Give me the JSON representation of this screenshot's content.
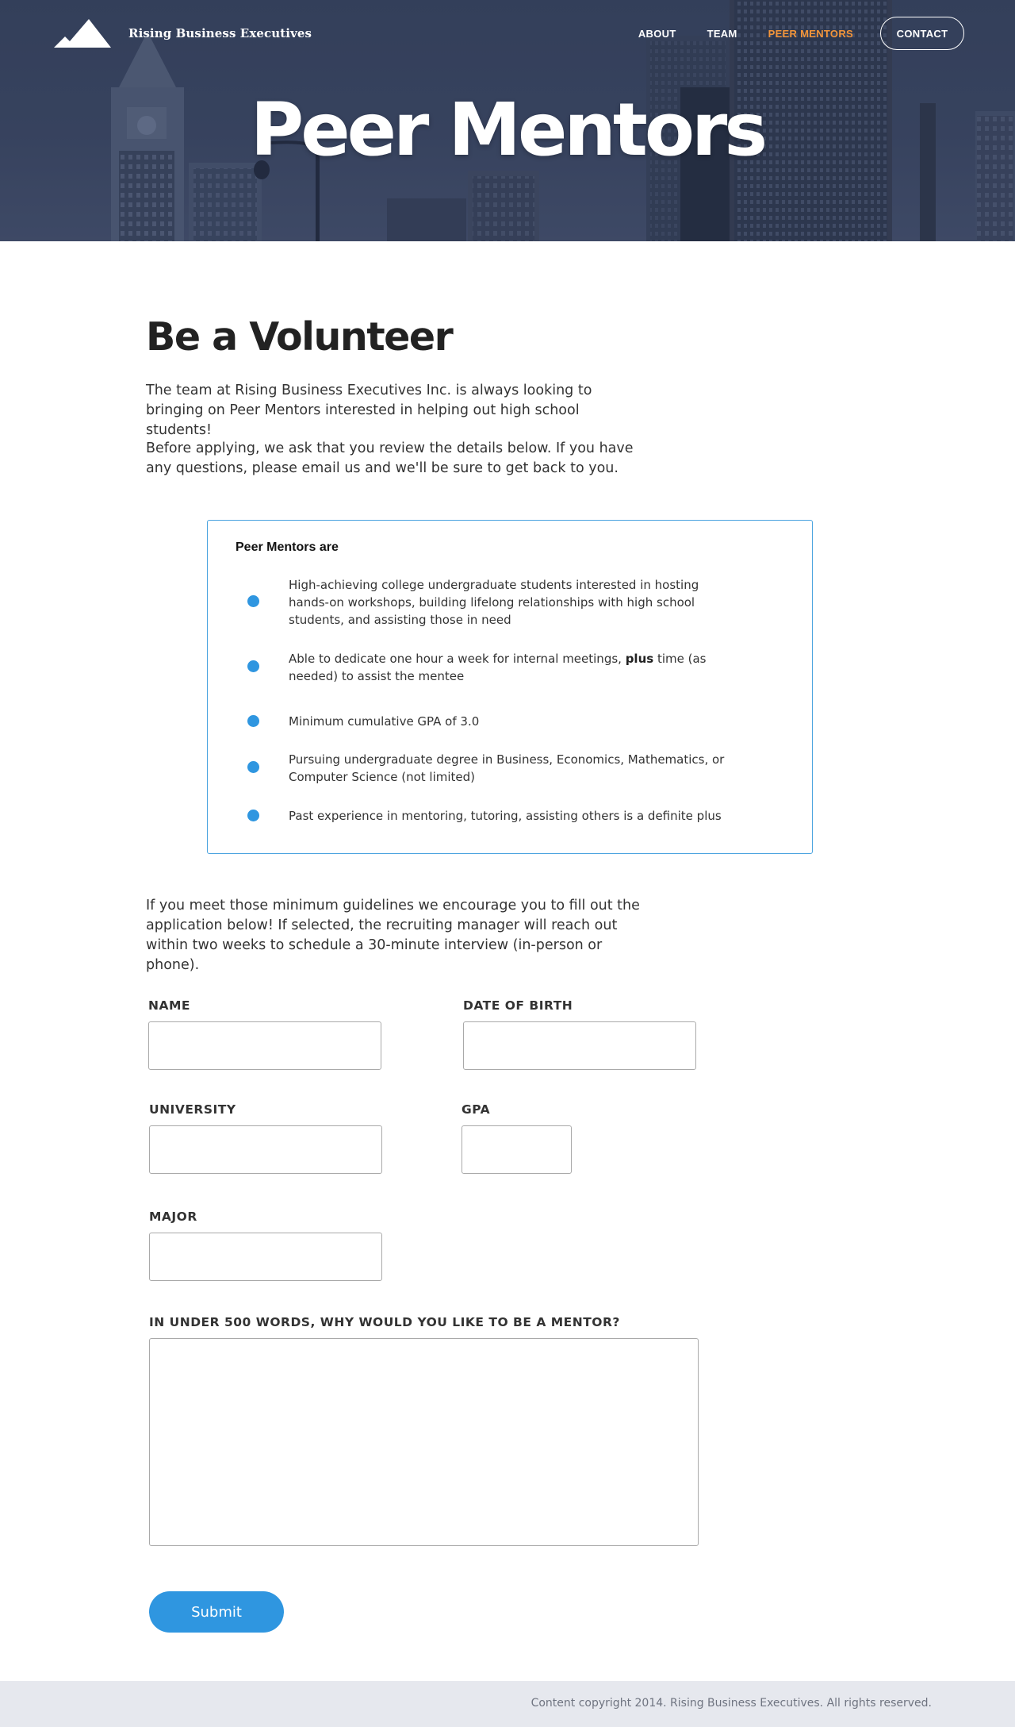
{
  "brand": {
    "name": "Rising Business Executives",
    "logo_icon": "mountain-icon"
  },
  "nav": {
    "items": [
      {
        "label": "ABOUT",
        "active": false
      },
      {
        "label": "TEAM",
        "active": false
      },
      {
        "label": "PEER MENTORS",
        "active": true
      },
      {
        "label": "CONTACT",
        "active": false
      }
    ],
    "active_color": "#f3953a"
  },
  "hero": {
    "title": "Peer Mentors"
  },
  "intro": {
    "heading": "Be a Volunteer",
    "paragraph1": "The team at Rising Business Executives Inc. is always looking to bringing on Peer Mentors interested in helping out high school students!",
    "paragraph2": "Before applying, we ask that you review the details below. If you have any questions, please email us and we'll be sure to get back to you."
  },
  "requirements": {
    "title": "Peer Mentors are",
    "items": [
      "High-achieving college undergraduate students interested in hosting hands-on workshops, building lifelong relationships with high school students, and assisting those in need",
      {
        "before": "Able to dedicate one hour a week for internal meetings, ",
        "bold": "plus",
        "after": " time (as needed) to assist the mentee"
      },
      "Minimum cumulative GPA of 3.0",
      "Pursuing undergraduate degree in Business, Economics, Mathematics, or Computer Science (not limited)",
      "Past experience in mentoring, tutoring, assisting others is a definite plus"
    ],
    "bullet_color": "#2f96e0",
    "border_color": "#4aa3df"
  },
  "guidelines": "If you meet those minimum guidelines we encourage you to fill out the application below! If selected, the recruiting manager will reach out within two weeks to schedule a 30-minute interview (in-person or phone).",
  "form": {
    "name_label": "NAME",
    "name_value": "",
    "dob_label": "DATE OF BIRTH",
    "dob_value": "",
    "university_label": "UNIVERSITY",
    "university_value": "",
    "gpa_label": "GPA",
    "gpa_value": "",
    "major_label": "MAJOR",
    "major_value": "",
    "essay_label": "IN UNDER 500 WORDS, WHY WOULD YOU LIKE TO BE A MENTOR?",
    "essay_value": "",
    "submit_label": "Submit",
    "accent_color": "#2f96e0"
  },
  "footer": {
    "copyright": "Content copyright 2014. Rising Business Executives. All rights reserved."
  }
}
